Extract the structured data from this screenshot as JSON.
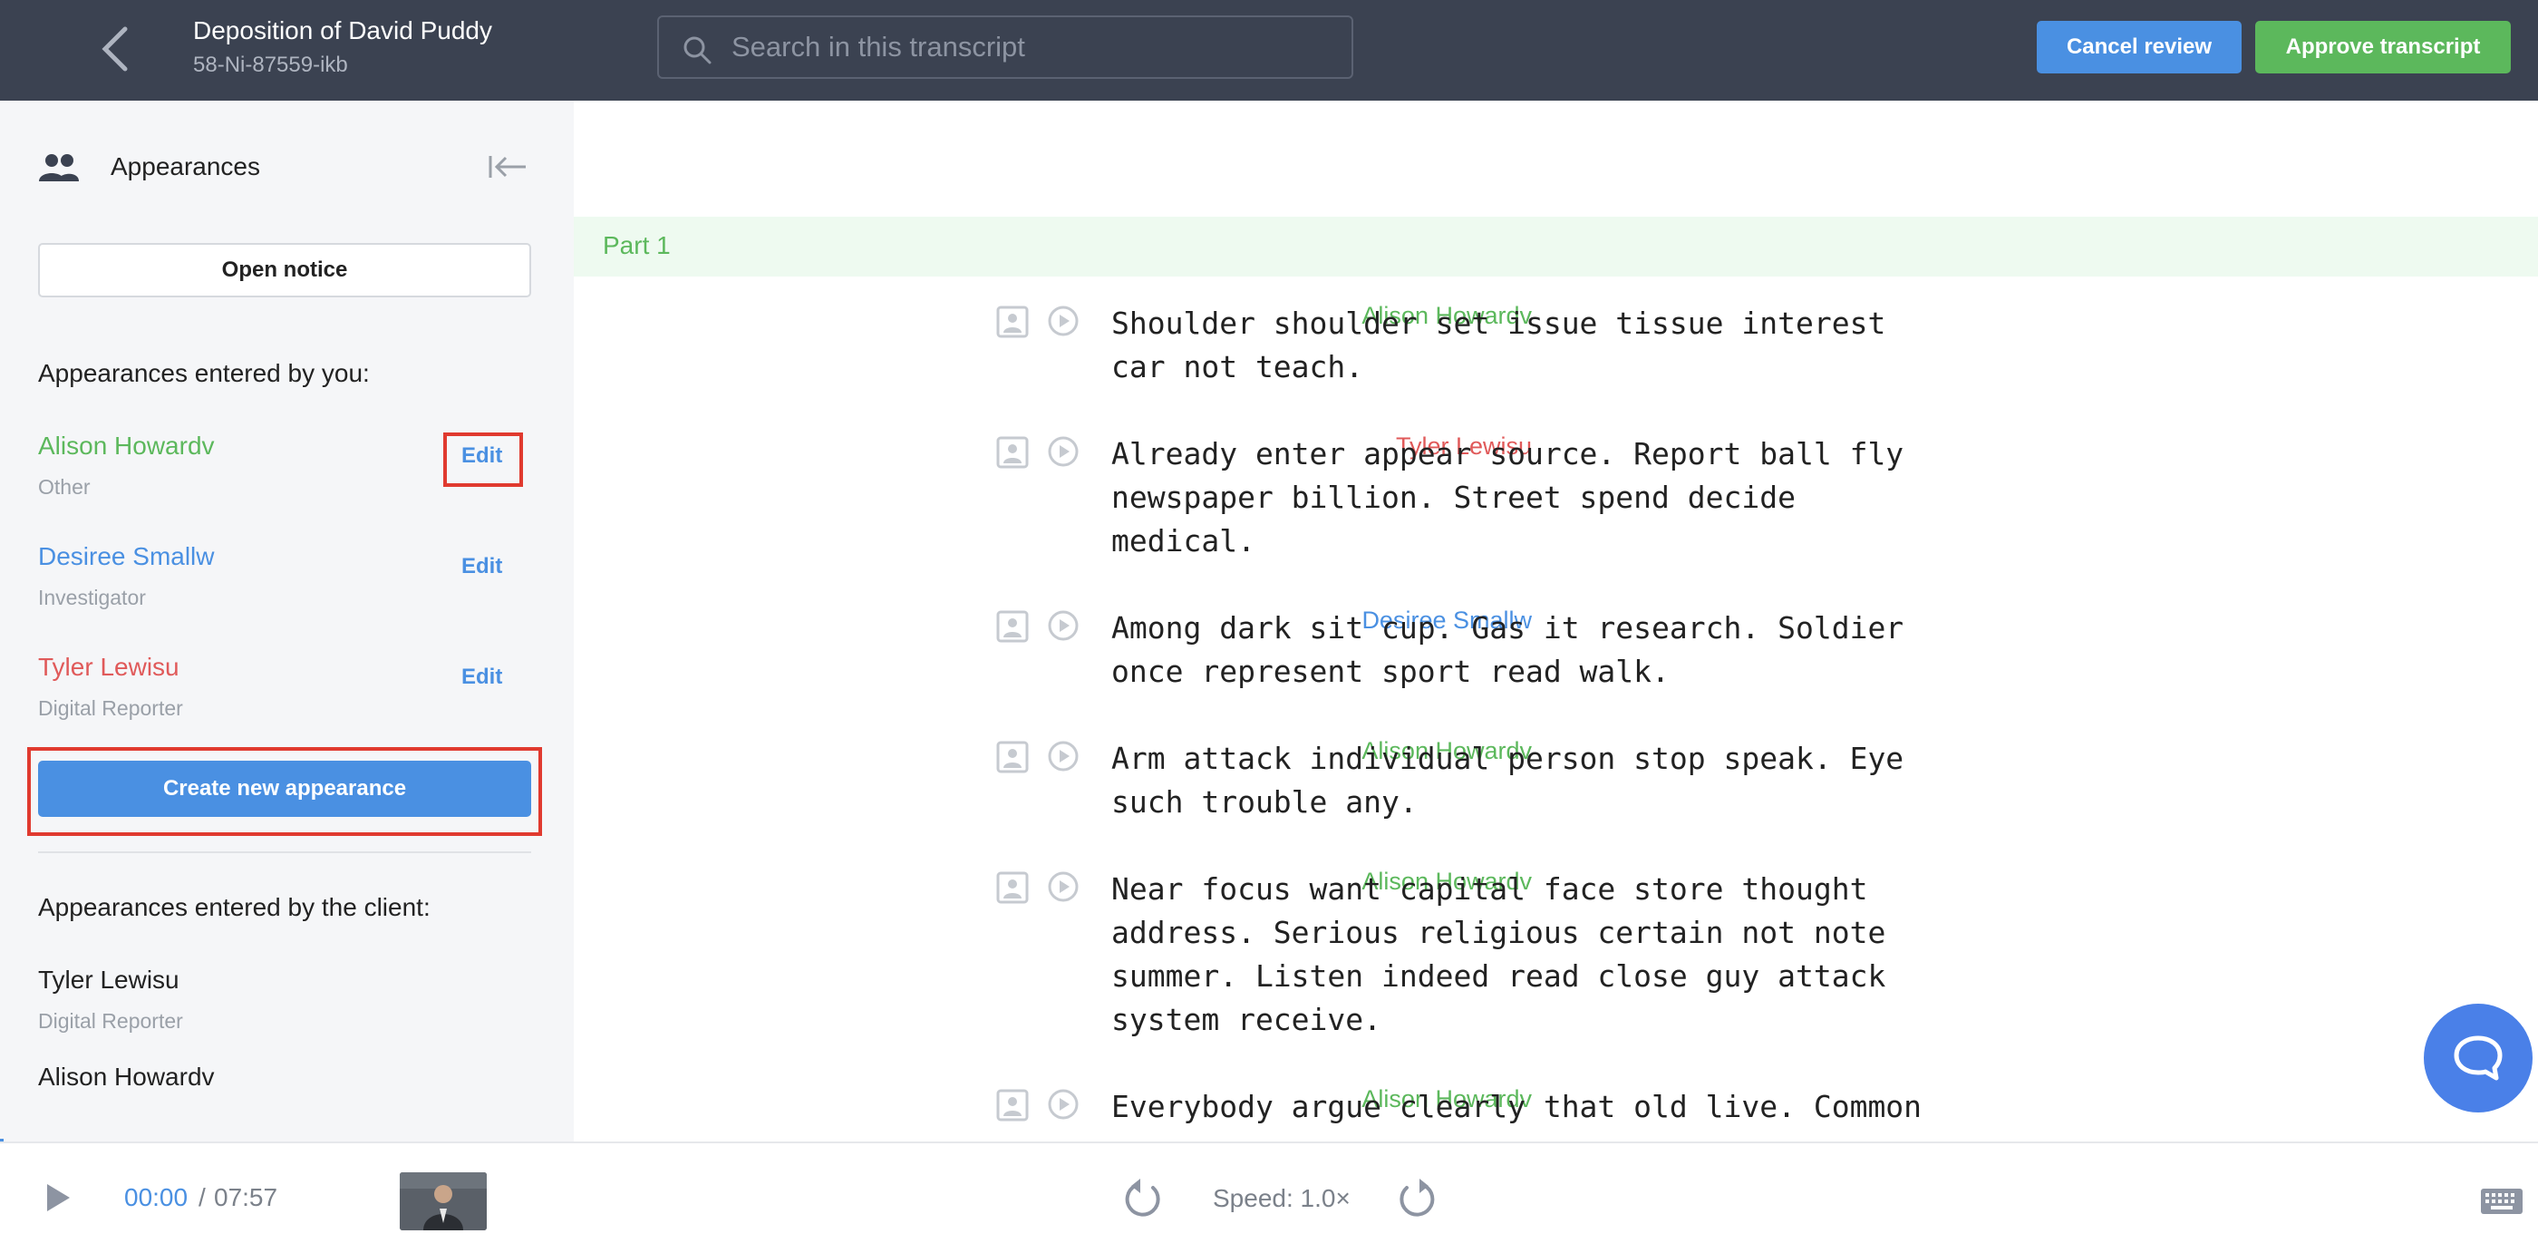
{
  "header": {
    "title": "Deposition of David Puddy",
    "subtitle": "58-Ni-87559-ikb",
    "search_placeholder": "Search in this transcript",
    "cancel_label": "Cancel review",
    "approve_label": "Approve transcript"
  },
  "sidebar": {
    "title": "Appearances",
    "open_notice_label": "Open notice",
    "by_you_heading": "Appearances entered by you:",
    "by_you": [
      {
        "name": "Alison Howardv",
        "role": "Other",
        "edit": "Edit",
        "color": "#5cb85c"
      },
      {
        "name": "Desiree Smallw",
        "role": "Investigator",
        "edit": "Edit",
        "color": "#4a90e2"
      },
      {
        "name": "Tyler Lewisu",
        "role": "Digital Reporter",
        "edit": "Edit",
        "color": "#e05a5a"
      }
    ],
    "create_label": "Create new appearance",
    "by_client_heading": "Appearances entered by the client:",
    "by_client": [
      {
        "name": "Tyler Lewisu",
        "role": "Digital Reporter"
      },
      {
        "name": "Alison Howardv",
        "role": ""
      }
    ]
  },
  "transcript": {
    "part_label": "Part 1",
    "utterances": [
      {
        "speaker": "Alison Howardv",
        "color": "#5cb85c",
        "text": "Shoulder shoulder set issue tissue interest\ncar not teach."
      },
      {
        "speaker": "Tyler Lewisu",
        "color": "#e05a5a",
        "text": "Already enter appear source. Report ball fly\nnewspaper billion. Street spend decide\nmedical."
      },
      {
        "speaker": "Desiree Smallw",
        "color": "#4a90e2",
        "text": "Among dark sit cup. Gas it research. Soldier\nonce represent sport read walk."
      },
      {
        "speaker": "Alison Howardv",
        "color": "#5cb85c",
        "text": "Arm attack individual person stop speak. Eye\nsuch trouble any."
      },
      {
        "speaker": "Alison Howardv",
        "color": "#5cb85c",
        "text": "Near focus want capital face store thought\naddress. Serious religious certain not note\nsummer. Listen indeed read close guy attack\nsystem receive."
      },
      {
        "speaker": "Alison Howardv",
        "color": "#5cb85c",
        "text": "Everybody argue clearly that old live. Common"
      }
    ]
  },
  "player": {
    "current_time": "00:00",
    "separator": "/",
    "duration": "07:57",
    "speed_label": "Speed: 1.0×",
    "progress": 0
  },
  "icons": [
    "chevron-left-icon",
    "search-icon",
    "people-icon",
    "collapse-left-icon",
    "image-icon",
    "play-circle-icon",
    "chat-icon",
    "play-icon",
    "rewind-icon",
    "forward-icon",
    "keyboard-icon"
  ]
}
